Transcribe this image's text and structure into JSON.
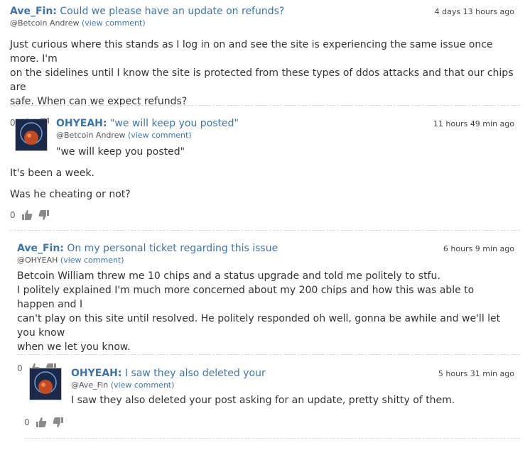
{
  "comments": [
    {
      "author": "Ave_Fin:",
      "title": "Could we please have an update on refunds?",
      "reply_to": "@Betcoin Andrew",
      "view_comment": "(view comment)",
      "time": "4 days 13 hours ago",
      "lines": [
        "Just curious where this stands as I log in on and see the site is experiencing the same issue once more. I'm",
        "on the sidelines until I know the site is protected from these types of ddos attacks and that our chips are",
        "safe. When can we expect refunds?"
      ],
      "votes": "0"
    },
    {
      "author": "OHYEAH:",
      "title": "\"we will keep you posted\"",
      "reply_to": "@Betcoin Andrew",
      "view_comment": "(view comment)",
      "time": "11 hours 49 min ago",
      "quote": "\"we will keep you posted\"",
      "lines": [
        "It's been a week.",
        "Was he cheating or not?"
      ],
      "votes": "0"
    },
    {
      "author": "Ave_Fin:",
      "title": "On my personal ticket regarding this issue",
      "reply_to": "@OHYEAH",
      "view_comment": "(view comment)",
      "time": "6 hours 9 min ago",
      "lines": [
        "Betcoin William threw me 10 chips and a status upgrade and told me politely to stfu.",
        "I politely explained I'm much more concerned about my 200 chips and how this was able to happen and I",
        "can't play on this site until resolved. He politely responded oh well, gonna be awhile and we'll let you know",
        "when we let you know."
      ],
      "votes": "0"
    },
    {
      "author": "OHYEAH:",
      "title": "I saw they also deleted your",
      "reply_to": "@Ave_Fin",
      "view_comment": "(view comment)",
      "time": "5 hours 31 min ago",
      "lines": [
        "I saw they also deleted your post asking for an update, pretty shitty of them."
      ],
      "votes": "0"
    }
  ]
}
